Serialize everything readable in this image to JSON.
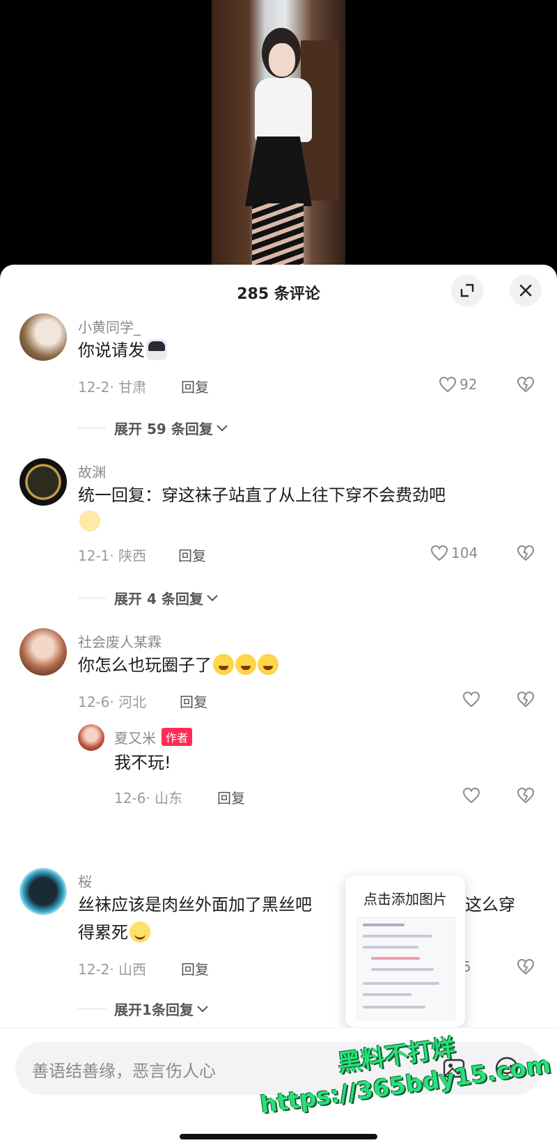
{
  "sheet": {
    "title": "285 条评论"
  },
  "comments": [
    {
      "user": "小黄同学_",
      "text": "你说请发",
      "date_loc": "12-2· 甘肃",
      "reply": "回复",
      "likes": "92",
      "expand": "展开 59 条回复"
    },
    {
      "user": "故渊",
      "text": "统一回复：穿这袜子站直了从上往下穿不会费劲吧",
      "date_loc": "12-1· 陕西",
      "reply": "回复",
      "likes": "104",
      "expand": "展开 4 条回复"
    },
    {
      "user": "社会废人某霖",
      "text": "你怎么也玩圈子了",
      "date_loc": "12-6· 河北",
      "reply": "回复",
      "likes": ""
    },
    {
      "user": "夏又米",
      "badge": "作者",
      "text": "我不玩!",
      "date_loc": "12-6· 山东",
      "reply": "回复",
      "likes": ""
    },
    {
      "user": "桜",
      "text_line1": "丝袜应该是肉丝外面加了黑丝吧",
      "text_line1_tail": "这么穿",
      "text_line2": "得累死",
      "date_loc": "12-2· 山西",
      "reply": "回复",
      "likes": "5",
      "expand": "展开1条回复"
    }
  ],
  "tooltip": {
    "title": "点击添加图片"
  },
  "input": {
    "placeholder": "善语结善缘，恶言伤人心"
  },
  "watermark": {
    "line1": "黑料不打烊",
    "line2": "https://365bdy15.com"
  },
  "colors": {
    "accent": "#fe2c55",
    "watermark": "#29e07a"
  }
}
